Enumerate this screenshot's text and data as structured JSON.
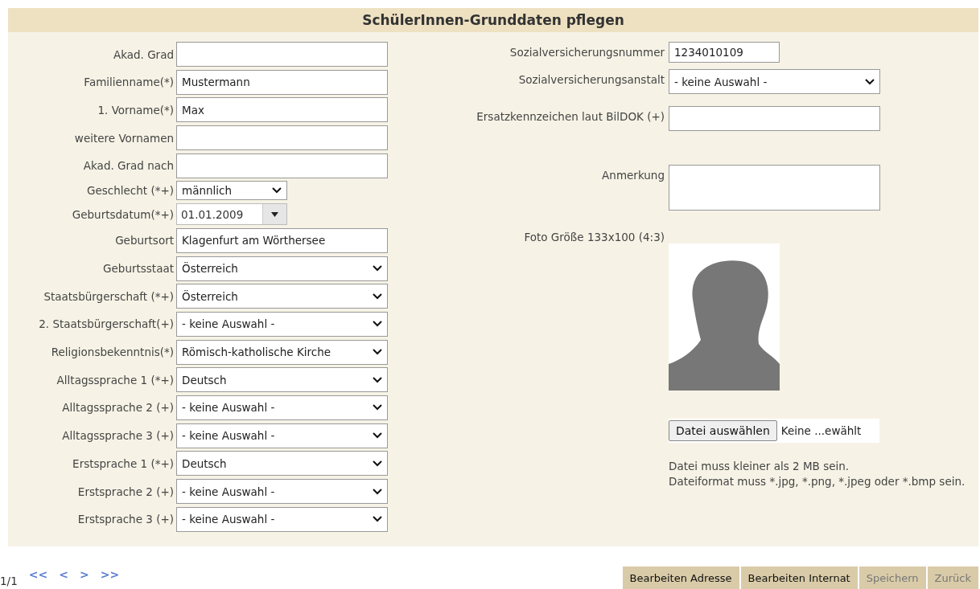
{
  "title": "SchülerInnen-Grunddaten pflegen",
  "left_fields": [
    {
      "label": "Akad. Grad",
      "kind": "text"
    },
    {
      "label": "Familienname(*)",
      "kind": "text",
      "value": "Mustermann"
    },
    {
      "label": "1. Vorname(*)",
      "kind": "text",
      "value": "Max"
    },
    {
      "label": "weitere Vornamen",
      "kind": "text"
    },
    {
      "label": "Akad. Grad nach",
      "kind": "text"
    },
    {
      "label": "Geschlecht (*+)",
      "kind": "short_select",
      "value": "männlich"
    },
    {
      "label": "Geburtsdatum(*+)",
      "kind": "date",
      "value": "01.01.2009"
    },
    {
      "label": "Geburtsort",
      "kind": "text",
      "value": "Klagenfurt am Wörthersee"
    },
    {
      "label": "Geburtsstaat",
      "kind": "select",
      "value": "Österreich"
    },
    {
      "label": "Staatsbürgerschaft (*+)",
      "kind": "select",
      "value": "Österreich"
    },
    {
      "label": "2. Staatsbürgerschaft(+)",
      "kind": "select",
      "value": "- keine Auswahl -"
    },
    {
      "label": "Religionsbekenntnis(*)",
      "kind": "select",
      "value": "Römisch-katholische Kirche"
    },
    {
      "label": "Alltagssprache 1 (*+)",
      "kind": "select",
      "value": "Deutsch"
    },
    {
      "label": "Alltagssprache 2 (+)",
      "kind": "select",
      "value": "- keine Auswahl -"
    },
    {
      "label": "Alltagssprache 3 (+)",
      "kind": "select",
      "value": "- keine Auswahl -"
    },
    {
      "label": "Erstsprache 1 (*+)",
      "kind": "select",
      "value": "Deutsch"
    },
    {
      "label": "Erstsprache 2 (+)",
      "kind": "select",
      "value": "- keine Auswahl -"
    },
    {
      "label": "Erstsprache 3 (+)",
      "kind": "select",
      "value": "- keine Auswahl -"
    }
  ],
  "right_fields": [
    {
      "label": "Sozialversicherungsnummer",
      "kind": "short_text",
      "value": "1234010109"
    },
    {
      "label": "Sozialversicherungsanstalt",
      "kind": "select",
      "value": "- keine Auswahl -"
    },
    {
      "label": "Ersatzkennzeichen laut BilDOK (+)",
      "kind": "text"
    },
    {
      "label": "Anmerkung",
      "kind": "textarea"
    }
  ],
  "photo": {
    "label": "Foto Größe 133x100 (4:3)",
    "file_button": "Datei auswählen",
    "file_status": "Keine ...ewählt",
    "notes": [
      "Datei muss kleiner als 2 MB sein.",
      "Dateiformat muss *.jpg, *.png, *.jpeg oder *.bmp sein."
    ]
  },
  "pager": {
    "page": "1/1",
    "links": [
      "<<",
      "<",
      ">",
      ">>"
    ]
  },
  "buttons": [
    {
      "label": "Bearbeiten Adresse",
      "disabled": false
    },
    {
      "label": "Bearbeiten Internat",
      "disabled": false
    },
    {
      "label": "Speichern",
      "disabled": true
    },
    {
      "label": "Zurück",
      "disabled": true
    }
  ]
}
